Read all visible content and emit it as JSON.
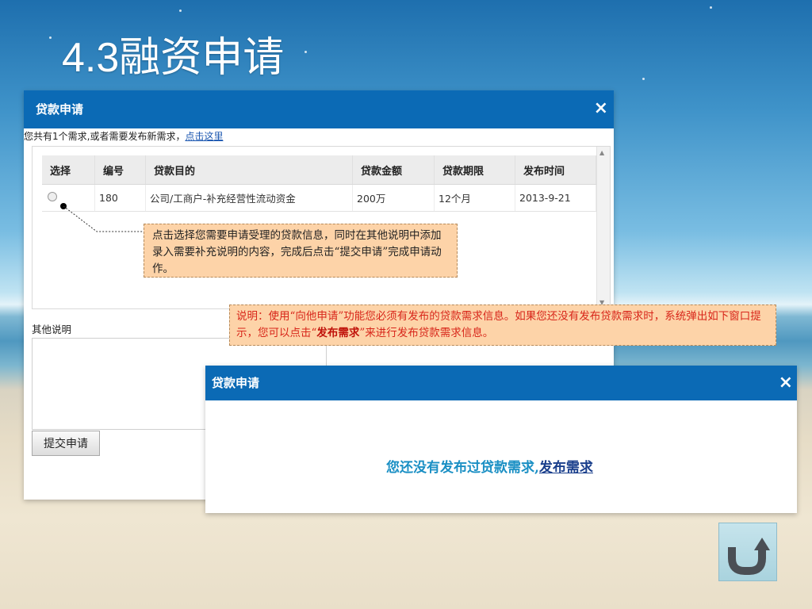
{
  "slide": {
    "title": "4.3融资申请"
  },
  "dialog": {
    "title": "贷款申请",
    "close_glyph": "×",
    "notice_text": "您共有1个需求,或者需要发布新需求，",
    "notice_link": "点击这里",
    "table": {
      "headers": [
        "选择",
        "编号",
        "贷款目的",
        "贷款金额",
        "贷款期限",
        "发布时间"
      ],
      "rows": [
        {
          "id": "180",
          "purpose": "公司/工商户-补充经营性流动资金",
          "amount": "200万",
          "term": "12个月",
          "date": "2013-9-21"
        }
      ]
    },
    "other_label": "其他说明",
    "submit_label": "提交申请"
  },
  "callout1": {
    "text": "点击选择您需要申请受理的贷款信息，同时在其他说明中添加录入需要补充说明的内容，完成后点击“提交申请”完成申请动作。"
  },
  "callout2": {
    "text_before": "说明：使用“向他申请”功能您必须有发布的贷款需求信息。如果您还没有发布贷款需求时，系统弹出如下窗口提示，您可以点击“",
    "bold": "发布需求",
    "text_after": "”来进行发布贷款需求信息。"
  },
  "dialog2": {
    "title": "贷款申请",
    "close_glyph": "×",
    "message": "您还没有发布过贷款需求,",
    "link": "发布需求"
  },
  "return_icon": "return-arrow-icon"
}
